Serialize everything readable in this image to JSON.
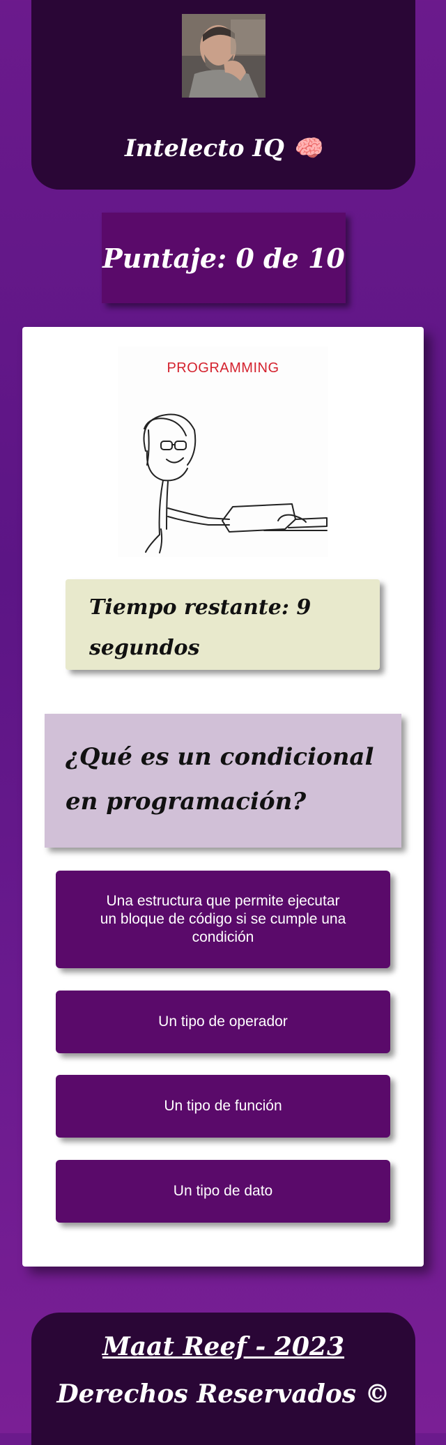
{
  "header": {
    "title": "Intelecto IQ 🧠"
  },
  "score": {
    "text": "Puntaje: 0 de 10"
  },
  "meme": {
    "label": "PROGRAMMING"
  },
  "timer": {
    "text": "Tiempo restante: 9 segundos"
  },
  "question": {
    "text": "¿Qué es un condicional en programación?"
  },
  "answers": [
    {
      "label": "Una estructura que permite ejecutar un bloque de código si se cumple una condición"
    },
    {
      "label": "Un tipo de operador"
    },
    {
      "label": "Un tipo de función"
    },
    {
      "label": "Un tipo de dato"
    }
  ],
  "footer": {
    "author": "Maat Reef - 2023",
    "rights": "Derechos Reservados ©"
  },
  "colors": {
    "background": "#6b1a8c",
    "header_bg": "#2a0636",
    "button_bg": "#5a0a6a",
    "timer_bg": "#e8e9cc",
    "question_bg": "#d1c0d7",
    "meme_label": "#d4222e"
  }
}
